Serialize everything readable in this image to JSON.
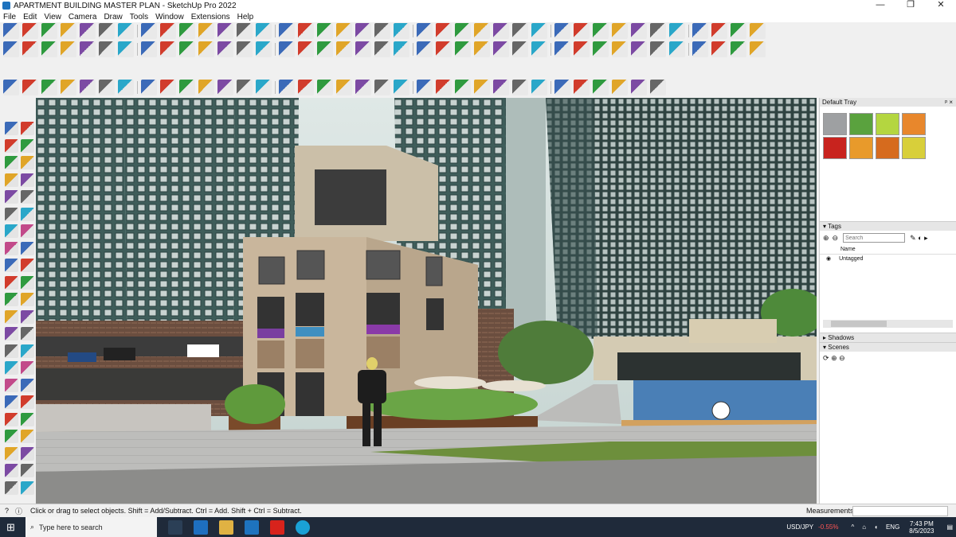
{
  "window": {
    "title": "APARTMENT BUILDING MASTER PLAN - SketchUp Pro 2022",
    "min": "—",
    "max": "❐",
    "close": "✕"
  },
  "menu": [
    "File",
    "Edit",
    "View",
    "Camera",
    "Draw",
    "Tools",
    "Window",
    "Extensions",
    "Help"
  ],
  "tray": {
    "title": "Default Tray",
    "pin": "ᵖ ×",
    "materials": [
      "#9ea0a2",
      "#5aa23e",
      "#b4d640",
      "#e8872c",
      "#c8231e",
      "#e89a2b",
      "#d66b1e",
      "#d8cf3a"
    ],
    "tags": {
      "header": "Tags",
      "search_placeholder": "Search",
      "column": "Name",
      "items": [
        "Untagged"
      ]
    },
    "shadows": "Shadows",
    "scenes": "Scenes"
  },
  "status": {
    "text": "Click or drag to select objects. Shift = Add/Subtract. Ctrl = Add. Shift + Ctrl = Subtract.",
    "measurements": "Measurements"
  },
  "taskbar": {
    "search_placeholder": "Type here to search",
    "ticker": "USD/JPY",
    "ticker_change": "-0.55%",
    "lang": "ENG",
    "time": "7:43 PM",
    "date": "8/5/2023"
  },
  "colors": {
    "accent": "#1e73be",
    "sky": "#d8e4e2",
    "tower": "#4a6d69",
    "ticker_neg": "#ff5555"
  }
}
